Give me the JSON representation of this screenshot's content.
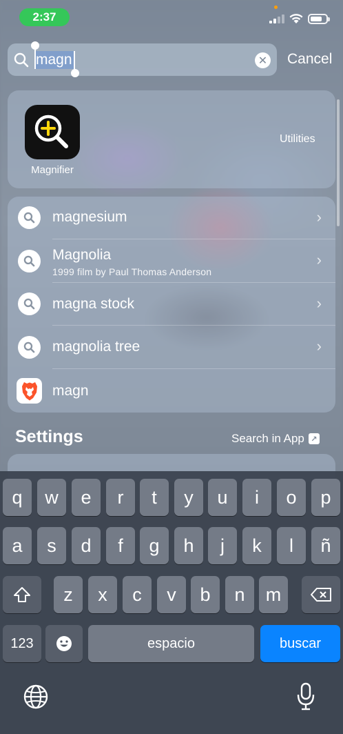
{
  "status_bar": {
    "time": "2:37",
    "battery_level": 0.8,
    "signal_bars_active": 2
  },
  "search": {
    "query": "magn",
    "cancel_label": "Cancel",
    "clear_icon": "close-icon"
  },
  "top_hit": {
    "app_name": "Magnifier",
    "category": "Utilities",
    "icon": "magnifier-icon"
  },
  "suggestions": [
    {
      "text": "magnesium",
      "subtitle": "",
      "icon": "search-icon"
    },
    {
      "text": "Magnolia",
      "subtitle": "1999 film by Paul Thomas Anderson",
      "icon": "search-icon"
    },
    {
      "text": "magna stock",
      "subtitle": "",
      "icon": "search-icon"
    },
    {
      "text": "magnolia tree",
      "subtitle": "",
      "icon": "search-icon"
    },
    {
      "text": "magn",
      "subtitle": "",
      "icon": "brave-icon"
    }
  ],
  "settings_section": {
    "title": "Settings",
    "search_in_app": "Search in App"
  },
  "keyboard": {
    "row1": [
      "q",
      "w",
      "e",
      "r",
      "t",
      "y",
      "u",
      "i",
      "o",
      "p"
    ],
    "row2": [
      "a",
      "s",
      "d",
      "f",
      "g",
      "h",
      "j",
      "k",
      "l",
      "ñ"
    ],
    "row3": [
      "z",
      "x",
      "c",
      "v",
      "b",
      "n",
      "m"
    ],
    "numbers_key": "123",
    "space_key": "espacio",
    "return_key": "buscar"
  },
  "colors": {
    "accent": "#0a84ff",
    "time_pill": "#35c759",
    "magnifier_plus": "#ffd60a",
    "brave": "#fb542b"
  }
}
